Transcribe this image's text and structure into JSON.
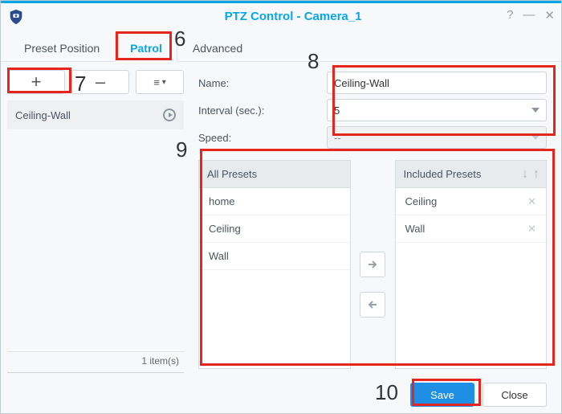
{
  "window": {
    "title": "PTZ Control - Camera_1"
  },
  "tabs": {
    "preset": "Preset Position",
    "patrol": "Patrol",
    "advanced": "Advanced",
    "active": "patrol"
  },
  "sidebar": {
    "items": [
      {
        "label": "Ceiling-Wall"
      }
    ],
    "count_text": "1 item(s)"
  },
  "fields": {
    "name_label": "Name:",
    "name_value": "Ceiling-Wall",
    "interval_label": "Interval (sec.):",
    "interval_value": "5",
    "speed_label": "Speed:",
    "speed_value": "--"
  },
  "presets": {
    "all_header": "All Presets",
    "included_header": "Included Presets",
    "all": [
      "home",
      "Ceiling",
      "Wall"
    ],
    "included": [
      "Ceiling",
      "Wall"
    ]
  },
  "footer": {
    "save": "Save",
    "close": "Close"
  },
  "annotations": {
    "n6": "6",
    "n7": "7",
    "n8": "8",
    "n9": "9",
    "n10": "10"
  }
}
